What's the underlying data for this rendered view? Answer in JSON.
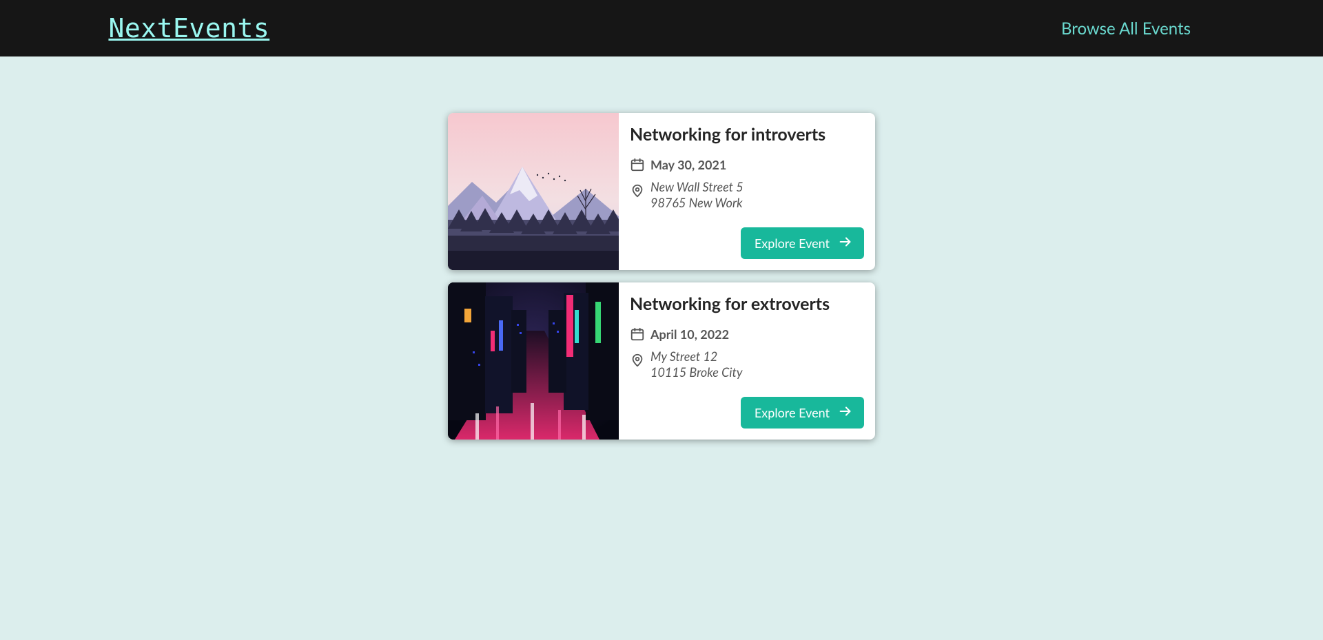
{
  "header": {
    "logo": "NextEvents",
    "nav": {
      "browse_all": "Browse All Events"
    }
  },
  "events": [
    {
      "title": "Networking for introverts",
      "date": "May 30, 2021",
      "address": "New Wall Street 5\n98765 New Work",
      "explore_label": "Explore Event",
      "image": "mountains"
    },
    {
      "title": "Networking for extroverts",
      "date": "April 10, 2022",
      "address": "My Street 12\n10115 Broke City",
      "explore_label": "Explore Event",
      "image": "neon-city"
    }
  ],
  "icons": {
    "calendar": "calendar-icon",
    "location": "location-pin-icon",
    "arrow": "arrow-right-icon"
  },
  "colors": {
    "accent": "#18b89b",
    "logo": "#9af7f0",
    "nav_link": "#6ad9cf",
    "bg": "#dceeed",
    "header_bg": "#161616"
  }
}
